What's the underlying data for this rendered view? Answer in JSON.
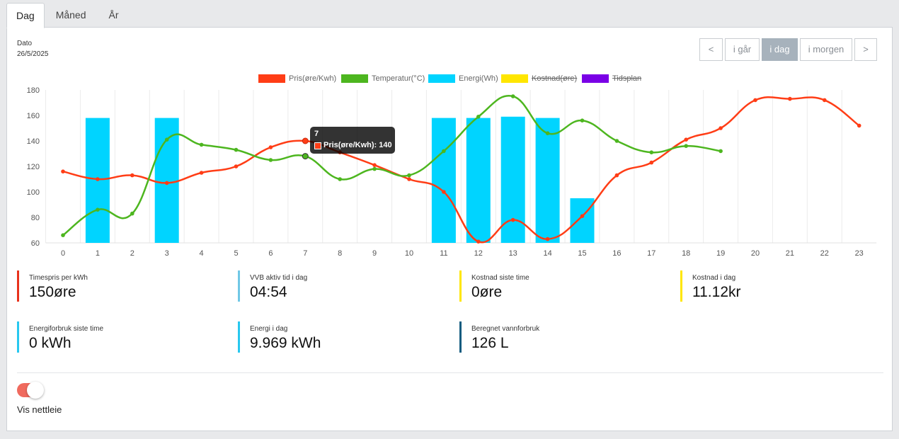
{
  "tabs": [
    {
      "label": "Dag",
      "active": true
    },
    {
      "label": "Måned",
      "active": false
    },
    {
      "label": "År",
      "active": false
    }
  ],
  "date": {
    "label": "Dato",
    "value": "26/5/2025"
  },
  "nav": {
    "prev": "<",
    "yesterday": "i går",
    "today": "i dag",
    "tomorrow": "i morgen",
    "next": ">"
  },
  "legend": [
    {
      "label": "Pris(øre/Kwh)",
      "color": "#ff3d16",
      "hidden": false
    },
    {
      "label": "Temperatur(°C)",
      "color": "#4db61f",
      "hidden": false
    },
    {
      "label": "Energi(Wh)",
      "color": "#00d4ff",
      "hidden": false
    },
    {
      "label": "Kostnad(øre)",
      "color": "#ffe600",
      "hidden": true
    },
    {
      "label": "Tidsplan",
      "color": "#7a00e6",
      "hidden": true
    }
  ],
  "chart_data": {
    "type": "bar",
    "categories": [
      "0",
      "1",
      "2",
      "3",
      "4",
      "5",
      "6",
      "7",
      "8",
      "9",
      "10",
      "11",
      "12",
      "13",
      "14",
      "15",
      "16",
      "17",
      "18",
      "19",
      "20",
      "21",
      "22",
      "23"
    ],
    "ylim": [
      60,
      180
    ],
    "yticks": [
      60,
      80,
      100,
      120,
      140,
      160,
      180
    ],
    "series": [
      {
        "name": "Pris(øre/Kwh)",
        "type": "line",
        "color": "#ff3d16",
        "values": [
          116,
          110,
          113,
          107,
          115,
          120,
          135,
          140,
          131,
          121,
          110,
          100,
          61,
          78,
          63,
          81,
          113,
          123,
          141,
          150,
          172,
          173,
          172,
          152
        ]
      },
      {
        "name": "Temperatur(°C)",
        "type": "line",
        "color": "#4db61f",
        "values": [
          66,
          86,
          83,
          141,
          137,
          133,
          125,
          128,
          110,
          118,
          113,
          132,
          159,
          175,
          146,
          156,
          140,
          131,
          136,
          132,
          null,
          null,
          null,
          null
        ]
      },
      {
        "name": "Energi(Wh)",
        "type": "bar",
        "color": "#00d4ff",
        "values": [
          null,
          158,
          null,
          158,
          null,
          null,
          null,
          null,
          null,
          null,
          null,
          158,
          158,
          159,
          158,
          95,
          null,
          null,
          null,
          null,
          null,
          null,
          null,
          null
        ]
      }
    ]
  },
  "tooltip": {
    "title": "7",
    "body": "Pris(øre/Kwh): 140"
  },
  "stats": [
    {
      "label": "Timespris per kWh",
      "value": "150øre",
      "color": "#e8321c"
    },
    {
      "label": "VVB aktiv tid i dag",
      "value": "04:54",
      "color": "#71c8e6"
    },
    {
      "label": "Kostnad siste time",
      "value": "0øre",
      "color": "#ffe600"
    },
    {
      "label": "Kostnad i dag",
      "value": "11.12kr",
      "color": "#ffe600"
    },
    {
      "label": "Energiforbruk siste time",
      "value": "0 kWh",
      "color": "#28c8ef"
    },
    {
      "label": "Energi i dag",
      "value": "9.969 kWh",
      "color": "#28c8ef"
    },
    {
      "label": "Beregnet vannforbruk",
      "value": "126 L",
      "color": "#135c80"
    }
  ],
  "toggle": {
    "label": "Vis nettleie",
    "on": true
  }
}
